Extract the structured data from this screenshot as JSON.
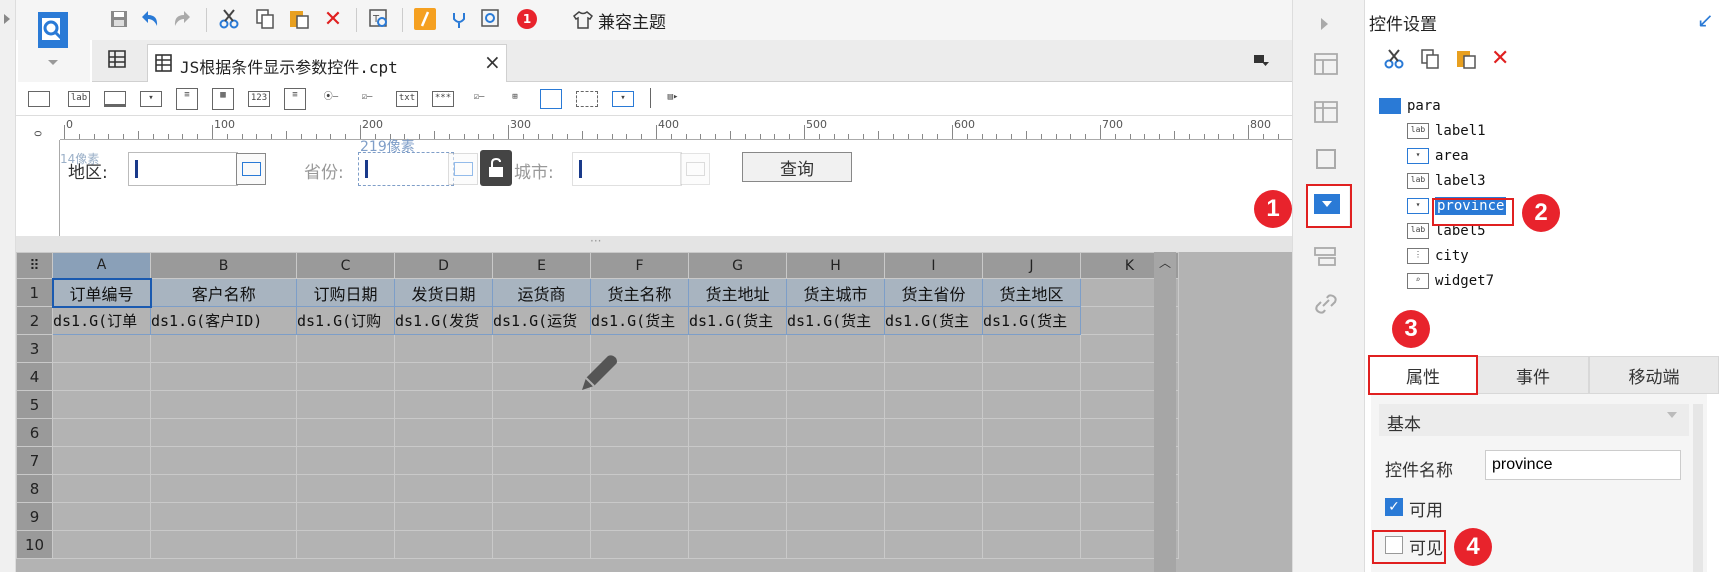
{
  "toolbar": {
    "compat_theme_label": "兼容主题",
    "notification_count": "1"
  },
  "tab": {
    "title": "JS根据条件显示参数控件.cpt",
    "close": "×"
  },
  "widget_toolbar": {
    "label_icon": "lab",
    "number_icon": "123",
    "text_icon": "txt",
    "password_icon": "***"
  },
  "ruler": {
    "ticks": [
      "0",
      "100",
      "200",
      "300",
      "400",
      "500",
      "600",
      "700",
      "800"
    ],
    "vertical_zero": "0"
  },
  "param": {
    "region_label": "地区:",
    "province_label": "省份:",
    "city_label": "城市:",
    "query_button": "查询",
    "size_hint": "219像素",
    "ghost_hint": "14像素"
  },
  "sheet": {
    "columns": [
      "A",
      "B",
      "C",
      "D",
      "E",
      "F",
      "G",
      "H",
      "I",
      "J",
      "K"
    ],
    "rows": [
      "1",
      "2",
      "3",
      "4",
      "5",
      "6",
      "7",
      "8",
      "9",
      "10"
    ],
    "headers": [
      "订单编号",
      "客户名称",
      "订购日期",
      "发货日期",
      "运货商",
      "货主名称",
      "货主地址",
      "货主城市",
      "货主省份",
      "货主地区"
    ],
    "data_row": [
      "ds1.G(订单",
      "ds1.G(客户ID)",
      "ds1.G(订购",
      "ds1.G(发货",
      "ds1.G(运货",
      "ds1.G(货主",
      "ds1.G(货主",
      "ds1.G(货主",
      "ds1.G(货主",
      "ds1.G(货主"
    ]
  },
  "panel": {
    "title": "控件设置",
    "tree": [
      {
        "icon": "param-root-icon",
        "label": "para"
      },
      {
        "icon": "label-icon",
        "label": "label1"
      },
      {
        "icon": "combo-icon",
        "label": "area"
      },
      {
        "icon": "label-icon",
        "label": "label3"
      },
      {
        "icon": "combo-icon",
        "label": "province"
      },
      {
        "icon": "label-icon",
        "label": "label5"
      },
      {
        "icon": "tree-combo-icon",
        "label": "city"
      },
      {
        "icon": "search-widget-icon",
        "label": "widget7"
      }
    ],
    "tabs": [
      "属性",
      "事件",
      "移动端"
    ],
    "section": "基本",
    "name_label": "控件名称",
    "name_value": "province",
    "enabled_label": "可用",
    "visible_label": "可见"
  },
  "badges": [
    "1",
    "2",
    "3",
    "4"
  ],
  "colors": {
    "accent_blue": "#2a7ad6",
    "badge_red": "#e8232c",
    "highlight_box": "#e02020"
  }
}
